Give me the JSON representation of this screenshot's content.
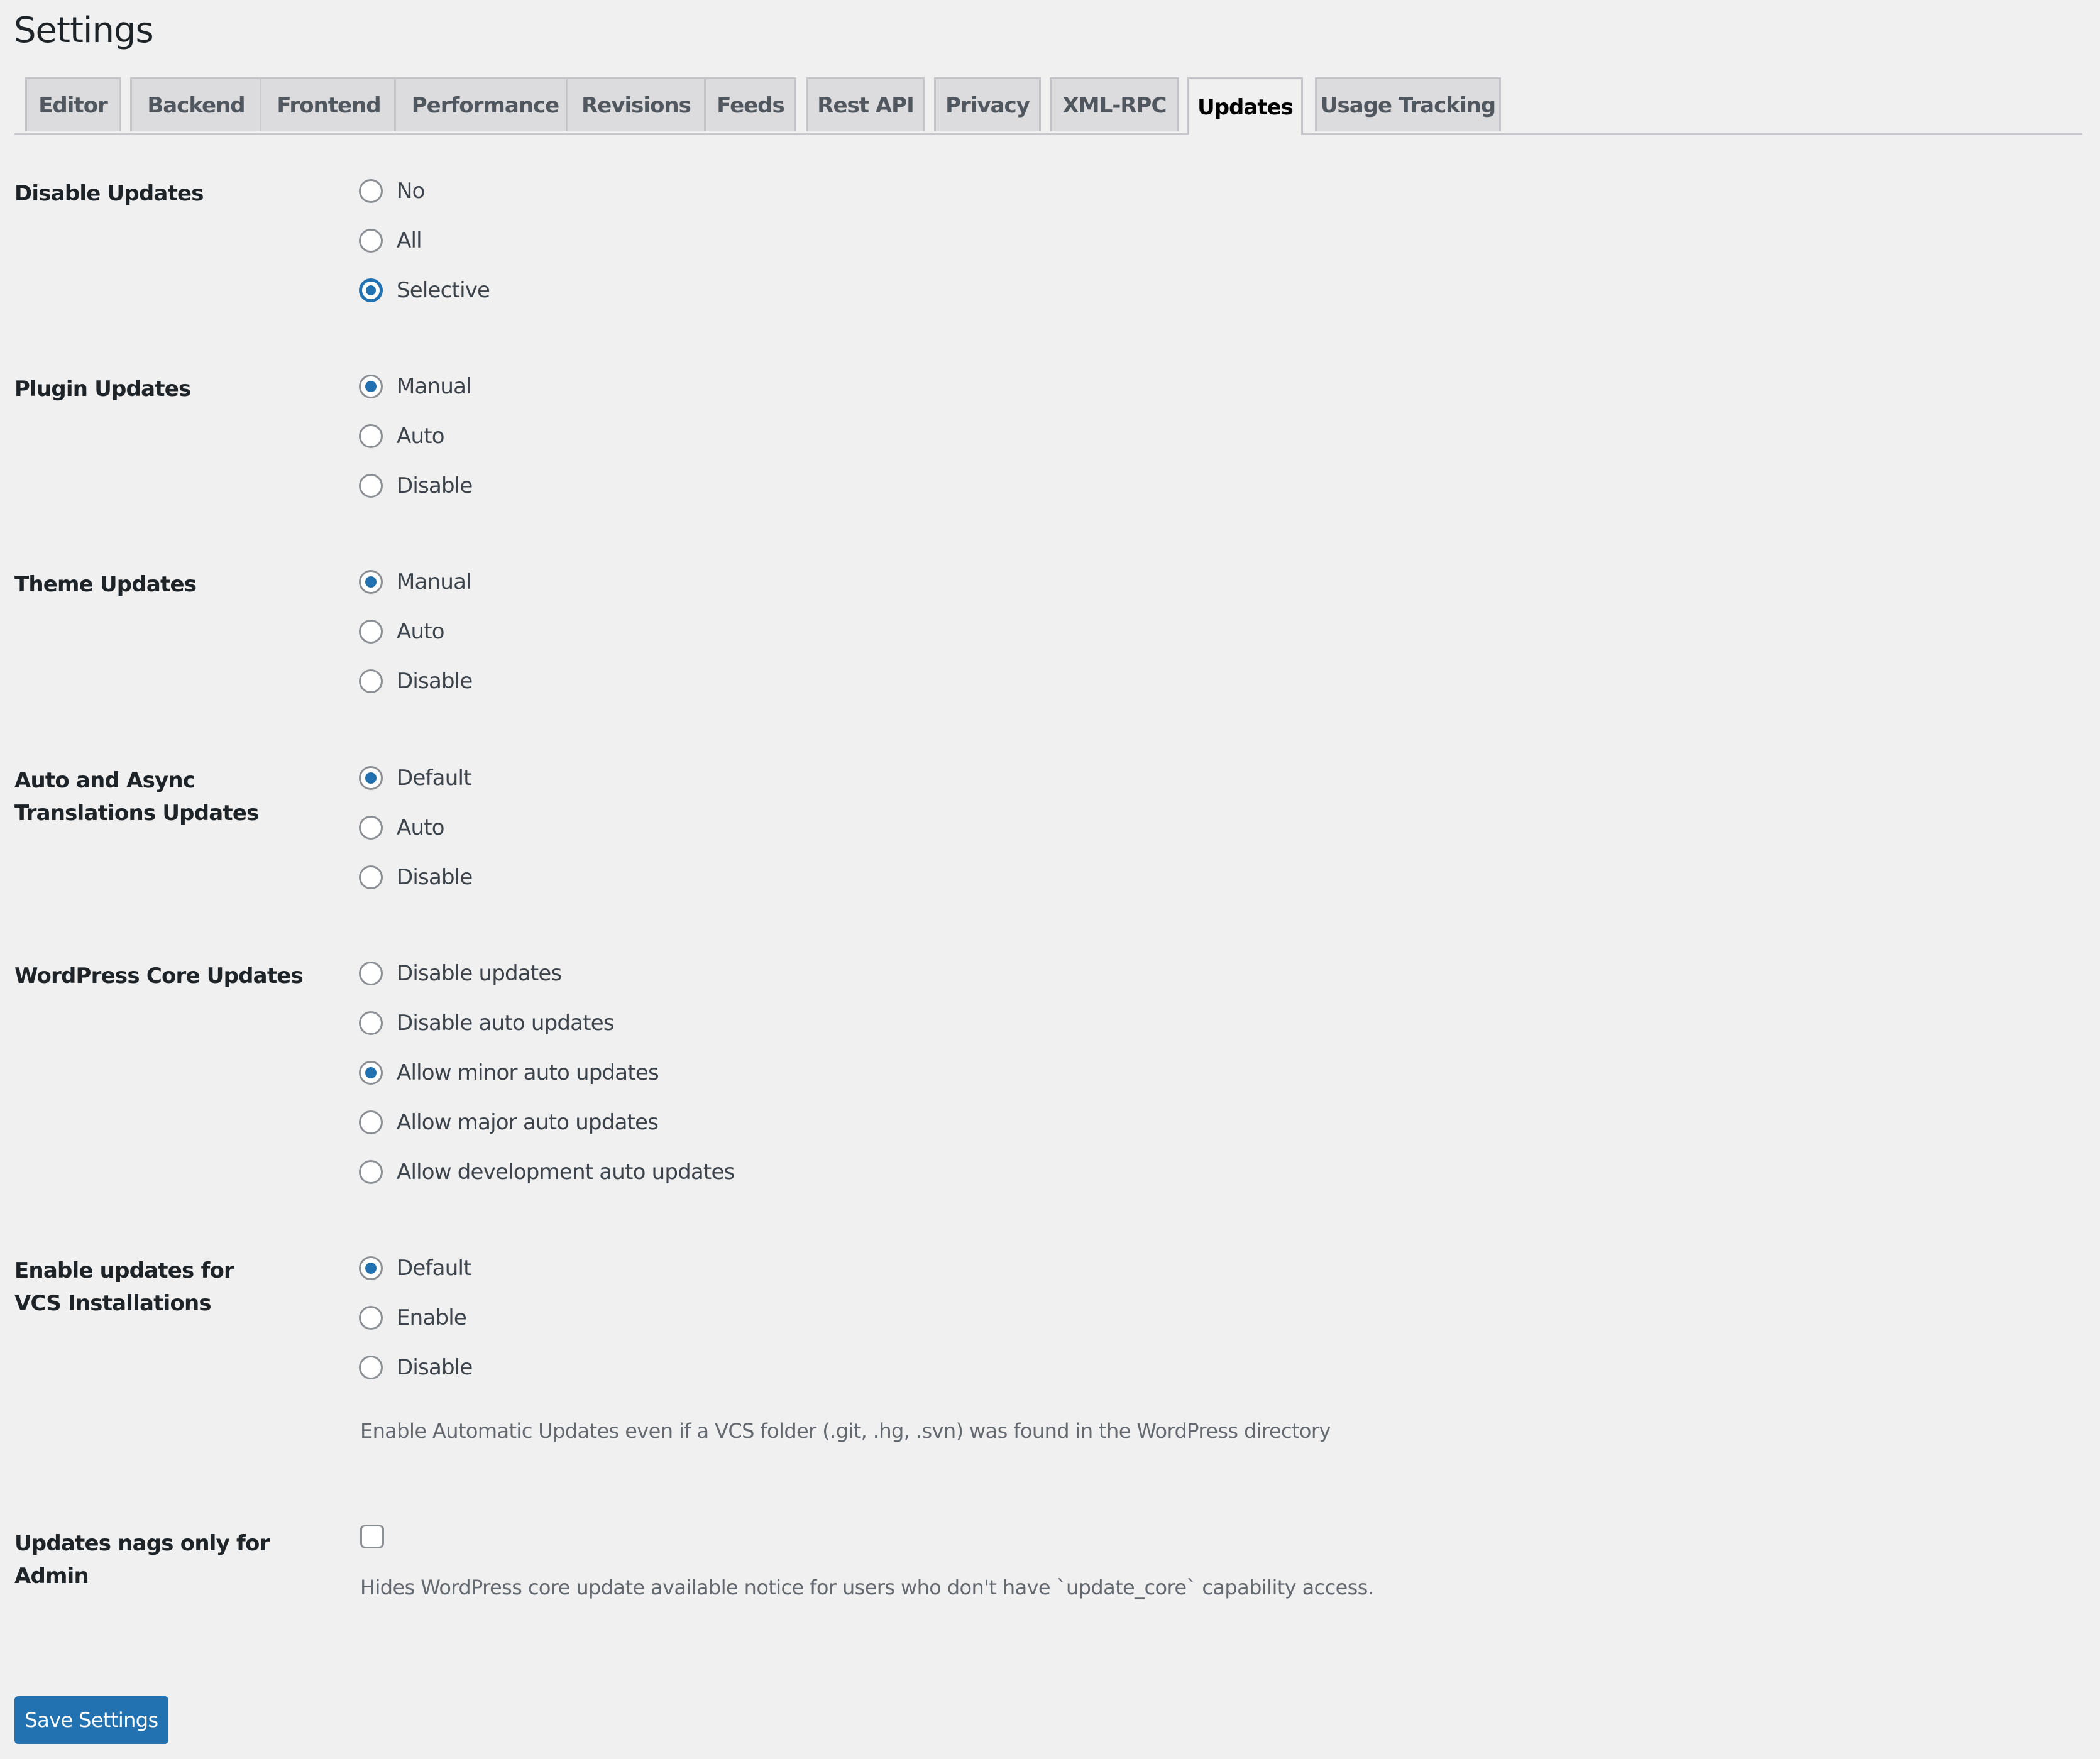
{
  "page": {
    "title": "Settings"
  },
  "tabs": [
    {
      "label": "Editor",
      "active": false
    },
    {
      "label": "Backend",
      "active": false
    },
    {
      "label": "Frontend",
      "active": false
    },
    {
      "label": "Performance",
      "active": false
    },
    {
      "label": "Revisions",
      "active": false
    },
    {
      "label": "Feeds",
      "active": false
    },
    {
      "label": "Rest API",
      "active": false
    },
    {
      "label": "Privacy",
      "active": false
    },
    {
      "label": "XML-RPC",
      "active": false
    },
    {
      "label": "Updates",
      "active": true
    },
    {
      "label": "Usage Tracking",
      "active": false
    }
  ],
  "sections": {
    "disable_updates": {
      "label": "Disable Updates",
      "options": [
        "No",
        "All",
        "Selective"
      ],
      "selected": "Selective"
    },
    "plugin_updates": {
      "label": "Plugin Updates",
      "options": [
        "Manual",
        "Auto",
        "Disable"
      ],
      "selected": "Manual"
    },
    "theme_updates": {
      "label": "Theme Updates",
      "options": [
        "Manual",
        "Auto",
        "Disable"
      ],
      "selected": "Manual"
    },
    "translation_updates": {
      "label": "Auto and Async Translations Updates",
      "options": [
        "Default",
        "Auto",
        "Disable"
      ],
      "selected": "Default"
    },
    "core_updates": {
      "label": "WordPress Core Updates",
      "options": [
        "Disable updates",
        "Disable auto updates",
        "Allow minor auto updates",
        "Allow major auto updates",
        "Allow development auto updates"
      ],
      "selected": "Allow minor auto updates"
    },
    "vcs_updates": {
      "label": "Enable updates for VCS Installations",
      "options": [
        "Default",
        "Enable",
        "Disable"
      ],
      "selected": "Default",
      "description": "Enable Automatic Updates even if a VCS folder (.git, .hg, .svn) was found in the WordPress directory"
    },
    "nags_admin": {
      "label": "Updates nags only for Admin",
      "checked": false,
      "description": "Hides WordPress core update available notice for users who don't have `update_core` capability access."
    }
  },
  "actions": {
    "save_label": "Save Settings"
  },
  "colors": {
    "accent": "#2271b1",
    "background": "#f0f0f1"
  }
}
